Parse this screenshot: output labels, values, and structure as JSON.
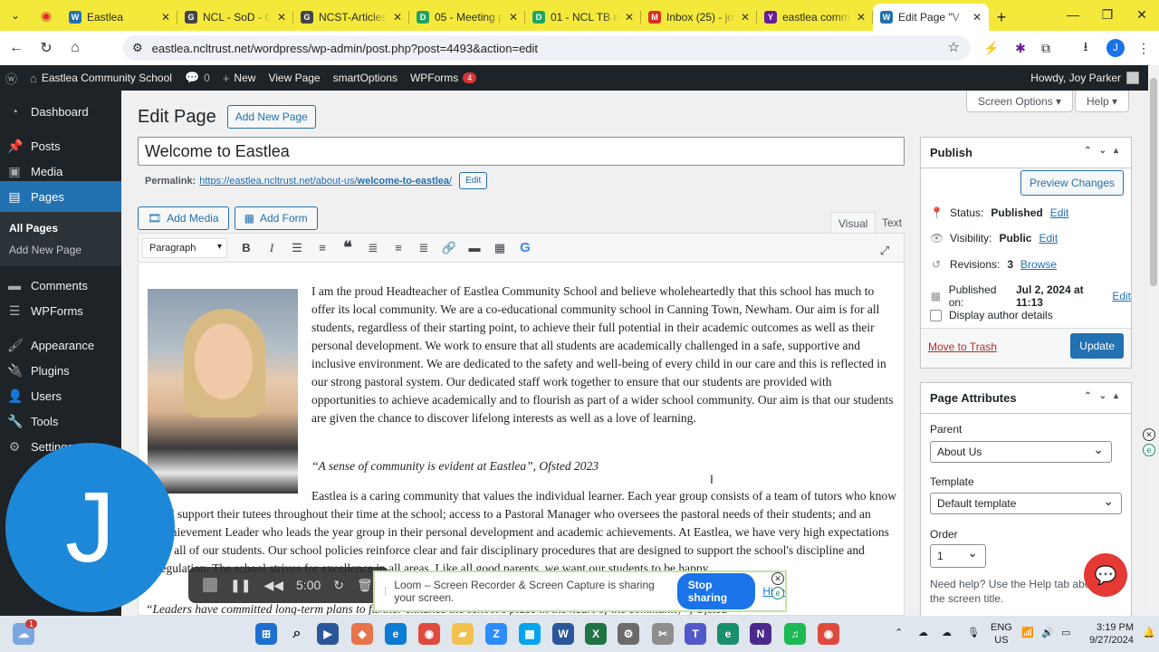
{
  "browser": {
    "tabs": [
      {
        "title": "Eastlea",
        "fav": "W",
        "color": "#2271b1"
      },
      {
        "title": "NCL - SoD - Go",
        "fav": "G",
        "color": "#444"
      },
      {
        "title": "NCST-Articles-c",
        "fav": "G",
        "color": "#444"
      },
      {
        "title": "05 - Meeting p",
        "fav": "D",
        "color": "#1fa463"
      },
      {
        "title": "01 - NCL TB me",
        "fav": "D",
        "color": "#1fa463"
      },
      {
        "title": "Inbox (25) - joy",
        "fav": "M",
        "color": "#d93025"
      },
      {
        "title": "eastlea commu",
        "fav": "Y",
        "color": "#6a1b9a"
      },
      {
        "title": "Edit Page \"V",
        "fav": "W",
        "color": "#2271b1"
      }
    ],
    "url": "eastlea.ncltrust.net/wordpress/wp-admin/post.php?post=4493&action=edit",
    "profile_initial": "J"
  },
  "adminbar": {
    "site": "Eastlea Community School",
    "comments": "0",
    "new": "New",
    "view": "View Page",
    "smart": "smartOptions",
    "wpforms": "WPForms",
    "wpforms_count": "4",
    "howdy": "Howdy, Joy Parker"
  },
  "sidebar": {
    "dashboard": "Dashboard",
    "posts": "Posts",
    "media": "Media",
    "pages": "Pages",
    "all_pages": "All Pages",
    "add_new_page": "Add New Page",
    "comments": "Comments",
    "wpforms": "WPForms",
    "appearance": "Appearance",
    "plugins": "Plugins",
    "users": "Users",
    "tools": "Tools",
    "settings": "Settings"
  },
  "editor": {
    "screen_options": "Screen Options ▾",
    "help": "Help ▾",
    "heading": "Edit Page",
    "add_new": "Add New Page",
    "title": "Welcome to Eastlea",
    "permalink_label": "Permalink:",
    "permalink_base": "https://eastlea.ncltrust.net/about-us/",
    "permalink_slug": "welcome-to-eastlea",
    "permalink_edit": "Edit",
    "add_media": "Add Media",
    "add_form": "Add Form",
    "tab_visual": "Visual",
    "tab_text": "Text",
    "format": "Paragraph",
    "para1": "I am the proud Headteacher of Eastlea Community School and believe wholeheartedly that this school has much to offer its local community. We are a co-educational community school in Canning Town, Newham. Our aim is for all students, regardless of their starting point, to achieve their full potential in their academic outcomes as well as their personal development. We work to ensure that all students are academically challenged in a safe, supportive and inclusive environment. We are dedicated to the safety and well-being of every child in our care and this is reflected in our strong pastoral system. Our dedicated staff work together to ensure that our students are provided with opportunities to achieve academically and to flourish as part of a wider school community. Our aim is that our students are given the chance to discover lifelong interests as well as a love of learning.",
    "quote": "“A sense of community is evident at Eastlea”, Ofsted 2023",
    "para2": "Eastlea is a caring community that values the individual learner. Each year group consists of a team of tutors who know and support their tutees throughout their time at the school; access to a Pastoral Manager who oversees the pastoral needs of their students; and an Achievement Leader who leads the year group in their personal development and academic achievements. At Eastlea, we have very high expectations for all of our students. Our school policies reinforce clear and fair disciplinary procedures that are designed to support the school's discipline and regulation. The school strives for excellence in all areas. Like all good parents, we want our students to be happy.",
    "para3": "“Leaders have committed long-term plans to further enhance the school's place in the heart of the community”, Ofsted"
  },
  "publish": {
    "title": "Publish",
    "preview": "Preview Changes",
    "status_label": "Status:",
    "status_value": "Published",
    "visibility_label": "Visibility:",
    "visibility_value": "Public",
    "revisions_label": "Revisions:",
    "revisions_value": "3",
    "browse": "Browse",
    "published_label": "Published on:",
    "published_value": "Jul 2, 2024 at 11:13",
    "edit": "Edit",
    "author": "Display author details",
    "trash": "Move to Trash",
    "update": "Update"
  },
  "attributes": {
    "title": "Page Attributes",
    "parent_label": "Parent",
    "parent_value": "About Us",
    "template_label": "Template",
    "template_value": "Default template",
    "order_label": "Order",
    "order_value": "1",
    "help": "Need help? Use the Help tab above the screen title."
  },
  "loom": {
    "avatar": "J",
    "timer": "5:00",
    "sharing_text": "Loom – Screen Recorder & Screen Capture is sharing your screen.",
    "stop": "Stop sharing",
    "hide": "Hide"
  },
  "taskbar": {
    "notification_count": "1",
    "lang": "ENG",
    "region": "US",
    "time": "3:19 PM",
    "date": "9/27/2024"
  }
}
